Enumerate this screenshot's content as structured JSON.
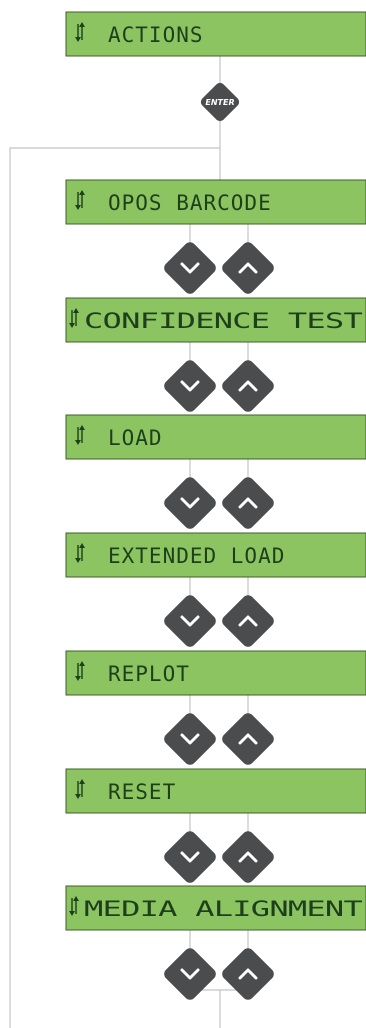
{
  "menu": {
    "header": "ACTIONS",
    "enter_label": "ENTER",
    "items": [
      {
        "label": "OPOS BARCODE"
      },
      {
        "label": "CONFIDENCE TEST"
      },
      {
        "label": "LOAD"
      },
      {
        "label": "EXTENDED LOAD"
      },
      {
        "label": "REPLOT"
      },
      {
        "label": "RESET"
      },
      {
        "label": "MEDIA ALIGNMENT"
      }
    ]
  },
  "icons": {
    "scroll": "up-down-scroll-arrows-icon",
    "enter": "enter-button-icon",
    "down": "chevron-down-icon",
    "up": "chevron-up-icon"
  },
  "colors": {
    "lcd_fill": "#8cc462",
    "lcd_border": "#3f5f2a",
    "lcd_text": "#1e3f1b",
    "button": "#4a4c4d",
    "connector": "#c4c4c4"
  }
}
